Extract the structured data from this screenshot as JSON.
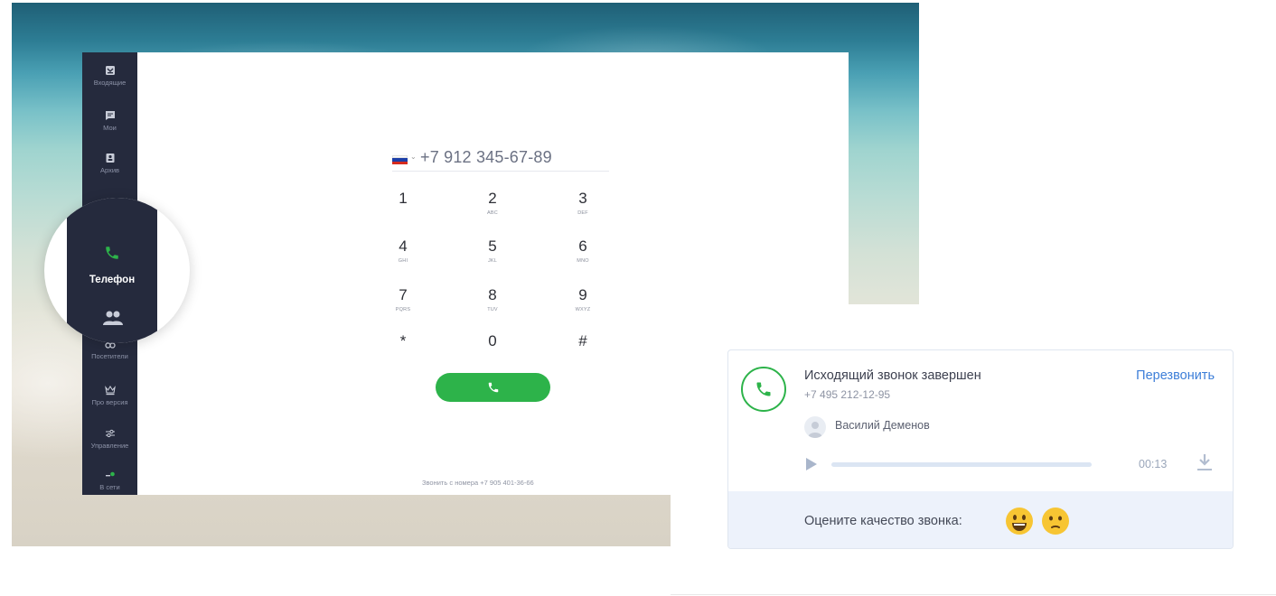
{
  "sidebar": {
    "items": [
      {
        "label": "Входящие",
        "icon": "inbox-icon"
      },
      {
        "label": "Мои",
        "icon": "chat-icon"
      },
      {
        "label": "Архив",
        "icon": "archive-icon"
      },
      {
        "label": "Телефон",
        "icon": "phone-icon"
      },
      {
        "label": "Посетители",
        "icon": "visitors-icon"
      },
      {
        "label": "Про версия",
        "icon": "crown-icon"
      },
      {
        "label": "Управление",
        "icon": "sliders-icon"
      },
      {
        "label": "В сети",
        "icon": "online-status-icon"
      }
    ],
    "magnified_label": "Телефон"
  },
  "dialer": {
    "country_flag": "russia-flag-icon",
    "phone_number": "+7 912 345-67-89",
    "keys": [
      {
        "digit": "1",
        "letters": ""
      },
      {
        "digit": "2",
        "letters": "ABC"
      },
      {
        "digit": "3",
        "letters": "DEF"
      },
      {
        "digit": "4",
        "letters": "GHI"
      },
      {
        "digit": "5",
        "letters": "JKL"
      },
      {
        "digit": "6",
        "letters": "MNO"
      },
      {
        "digit": "7",
        "letters": "PQRS"
      },
      {
        "digit": "8",
        "letters": "TUV"
      },
      {
        "digit": "9",
        "letters": "WXYZ"
      },
      {
        "digit": "*",
        "letters": ""
      },
      {
        "digit": "0",
        "letters": ""
      },
      {
        "digit": "#",
        "letters": ""
      }
    ],
    "call_from": "Звонить с номера +7 905 401-36-66"
  },
  "call_card": {
    "title": "Исходящий звонок завершен",
    "number": "+7 495 212-12-95",
    "callback_label": "Перезвонить",
    "agent_name": "Василий Деменов",
    "duration": "00:13",
    "playback_progress": 0,
    "rating_label": "Оцените качество звонка:",
    "rating_options": [
      "happy-emoji-icon",
      "neutral-emoji-icon"
    ]
  },
  "colors": {
    "sidebar_bg": "#252a3d",
    "accent_green": "#2db34a",
    "link_blue": "#3c7ed8",
    "rating_bg": "#edf2fb"
  }
}
